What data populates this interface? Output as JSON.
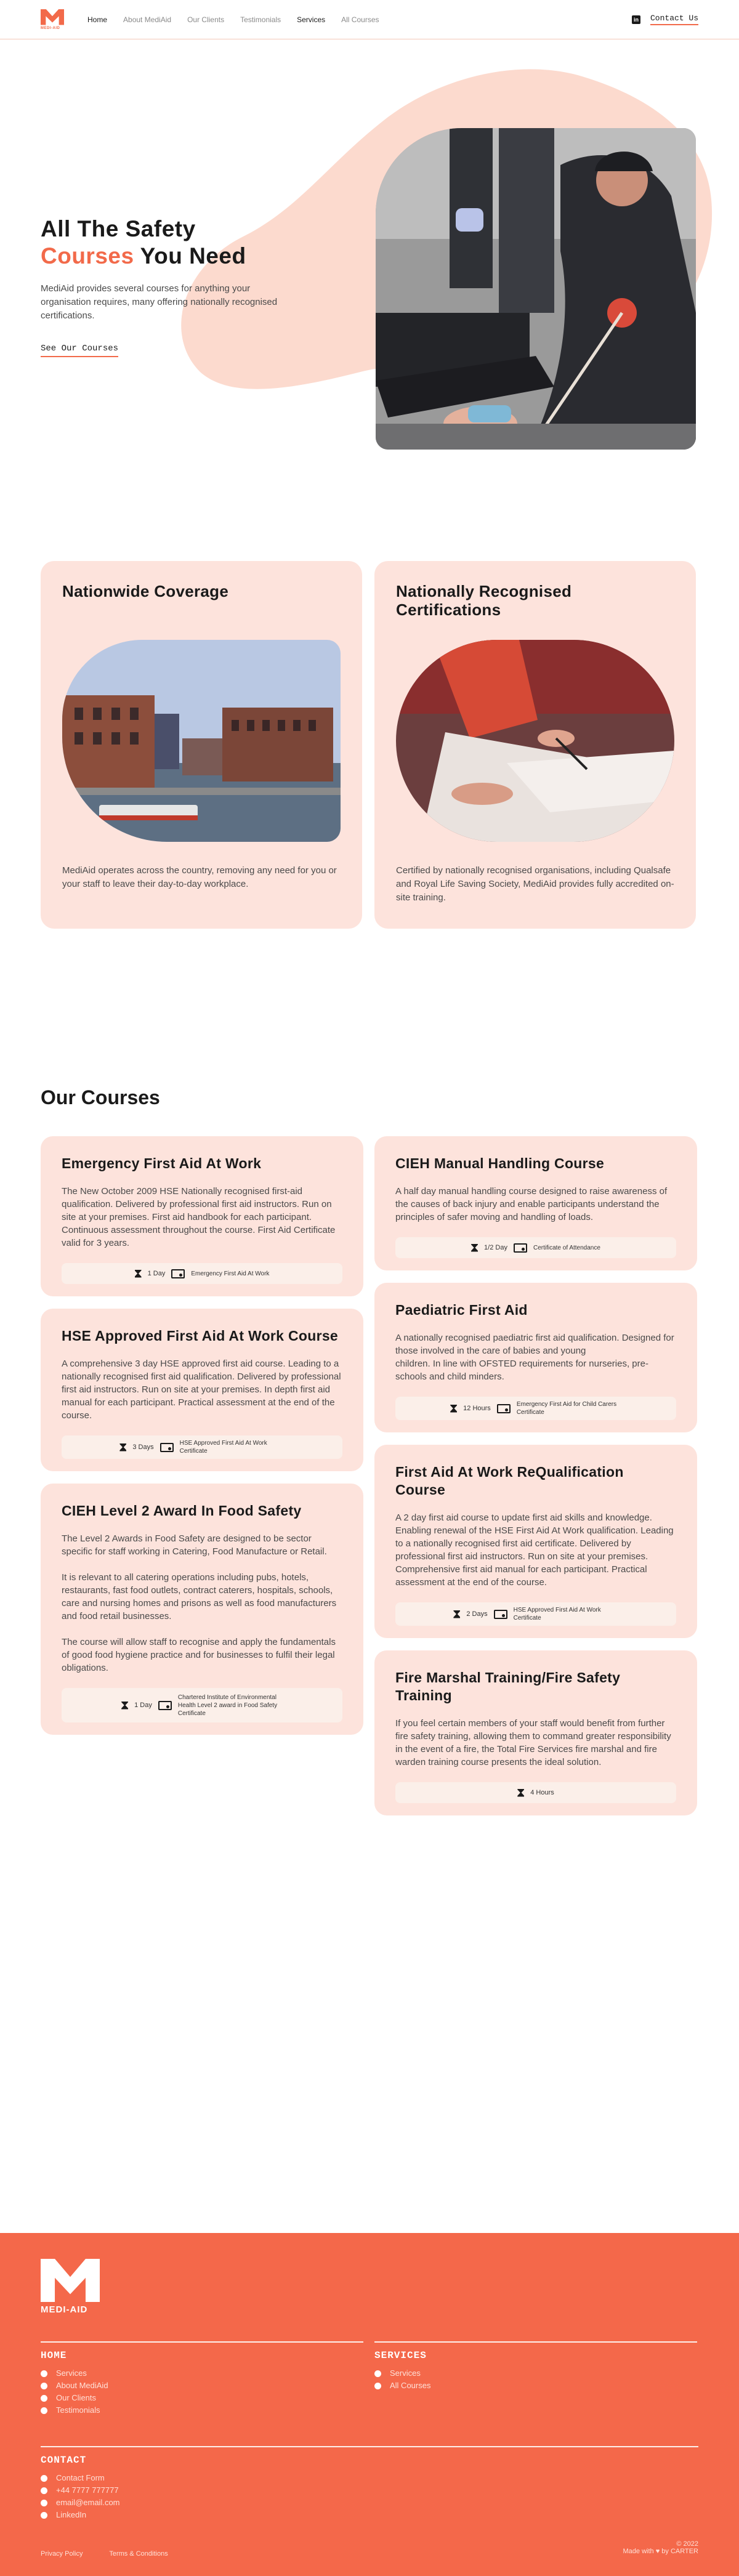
{
  "nav": {
    "logo_text": "MEDI-AID",
    "links": [
      "Home",
      "About MediAid",
      "Our Clients",
      "Testimonials",
      "Services",
      "All Courses"
    ],
    "linkedin_icon": "linkedin-icon",
    "contact": "Contact Us"
  },
  "hero": {
    "title_line1": "All The Safety",
    "title_accent": "Courses",
    "title_rest": " You Need",
    "description": "MediAid provides several courses for anything your organisation requires, many offering nationally recognised certifications.",
    "cta": "See  Our Courses"
  },
  "features": [
    {
      "title": "Nationwide Coverage",
      "text": "MediAid operates across the country, removing any need for you or your staff to leave their day-to-day workplace."
    },
    {
      "title": "Nationally Recognised Certifications",
      "text": "Certified by nationally recognised organisations, including Qualsafe and Royal Life Saving Society, MediAid provides fully accredited on-site training."
    }
  ],
  "courses_title": "Our Courses",
  "courses_left": [
    {
      "title": "Emergency First Aid At Work",
      "body": "The New October 2009 HSE Nationally recognised first-aid qualification. Delivered by professional first aid instructors. Run on site at your premises. First aid handbook for each participant. Continuous assessment throughout the course. First Aid Certificate valid for 3 years.",
      "duration": "1 Day",
      "certificate": "Emergency First Aid At Work"
    },
    {
      "title": "HSE Approved First Aid At Work Course",
      "body": "A comprehensive 3 day HSE approved first aid course. Leading to a nationally recognised first aid qualification. Delivered by professional first aid instructors. Run on site at your premises. In depth first aid manual for each participant. Practical assessment at the end of the course.",
      "duration": "3 Days",
      "certificate": "HSE Approved First Aid At Work Certificate"
    },
    {
      "title": "CIEH Level 2 Award In Food Safety",
      "body": "The Level 2 Awards in Food Safety are designed to be sector specific for staff working in Catering, Food Manufacture or Retail.\n\nIt is relevant to all catering operations including pubs, hotels, restaurants, fast food outlets, contract caterers, hospitals, schools, care and nursing homes and prisons as well as food manufacturers and food retail businesses.\n\nThe course will allow staff to recognise and apply the fundamentals of good food hygiene practice and for businesses to fulfil their legal obligations.",
      "duration": "1 Day",
      "certificate": "Chartered Institute of Environmental Health Level 2 award in Food Safety Certificate"
    }
  ],
  "courses_right": [
    {
      "title": "CIEH Manual Handling Course",
      "body": "A half day manual handling course designed to raise awareness of the causes of back injury and enable participants understand the principles of safer moving and handling of loads.",
      "duration": "1/2 Day",
      "certificate": "Certificate of Attendance"
    },
    {
      "title": "Paediatric First Aid",
      "body": "A nationally recognised paediatric first aid qualification. Designed for those involved in the care of babies and young\nchildren. In line with OFSTED requirements for nurseries, pre-schools and child minders.",
      "duration": "12 Hours",
      "certificate": "Emergency First Aid for Child Carers Certificate"
    },
    {
      "title": "First Aid At Work ReQualification Course",
      "body": "A 2 day first aid course to update first aid skills and knowledge. Enabling renewal of the HSE First Aid At Work qualification. Leading to a nationally recognised first aid certificate. Delivered by professional first aid instructors. Run on site at your premises. Comprehensive first aid manual for each participant. Practical assessment at the end of the course.",
      "duration": "2 Days",
      "certificate": "HSE Approved First Aid At Work Certificate"
    },
    {
      "title": "Fire Marshal Training/Fire Safety Training",
      "body": "If you feel certain members of your staff would benefit from further fire safety training, allowing them to command greater responsibility in the event of a fire, the Total Fire Services fire marshal and fire warden training course presents the ideal solution.",
      "duration": "4 Hours",
      "certificate": ""
    }
  ],
  "footer": {
    "logo_text": "MEDI-AID",
    "home_title": "HOME",
    "home_links": [
      "Services",
      "About MediAid",
      "Our Clients",
      "Testimonials"
    ],
    "services_title": "SERVICES",
    "services_links": [
      "Services",
      "All Courses"
    ],
    "contact_title": "CONTACT",
    "contact_links": [
      "Contact Form",
      "+44 7777 777777",
      "email@email.com",
      "LinkedIn"
    ],
    "legal": [
      "Privacy Policy",
      "Terms & Conditions"
    ],
    "copyright": "© 2022",
    "made_with": "Made with ♥ by CARTER"
  },
  "colors": {
    "accent": "#f26a4a",
    "card": "#fde3dc",
    "footer": "#f4684a"
  }
}
